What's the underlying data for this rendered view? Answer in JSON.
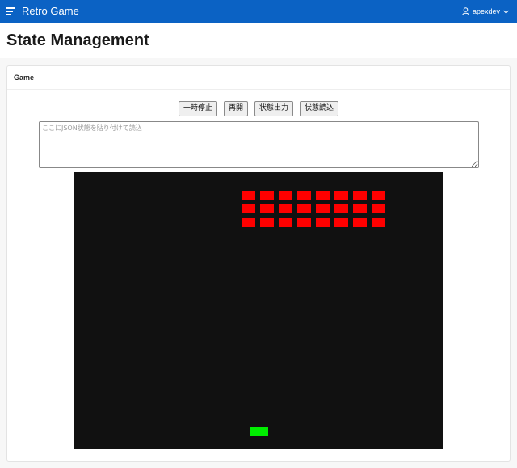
{
  "header": {
    "app_title": "Retro Game",
    "menu_icon": "hamburger-menu-icon",
    "user_icon": "user-icon",
    "username": "apexdev",
    "chevron_icon": "chevron-down-icon"
  },
  "page": {
    "title": "State Management"
  },
  "region": {
    "title": "Game"
  },
  "controls": {
    "buttons": [
      {
        "label": "一時停止"
      },
      {
        "label": "再開"
      },
      {
        "label": "状態出力"
      },
      {
        "label": "状態読込"
      }
    ],
    "state_input": {
      "placeholder": "ここにJSON状態を貼り付けて読込",
      "value": ""
    }
  },
  "game": {
    "background_color": "#111111",
    "brick_color": "#ff0000",
    "paddle_color": "#00ee00",
    "brick_rows": 3,
    "brick_columns": 8
  }
}
